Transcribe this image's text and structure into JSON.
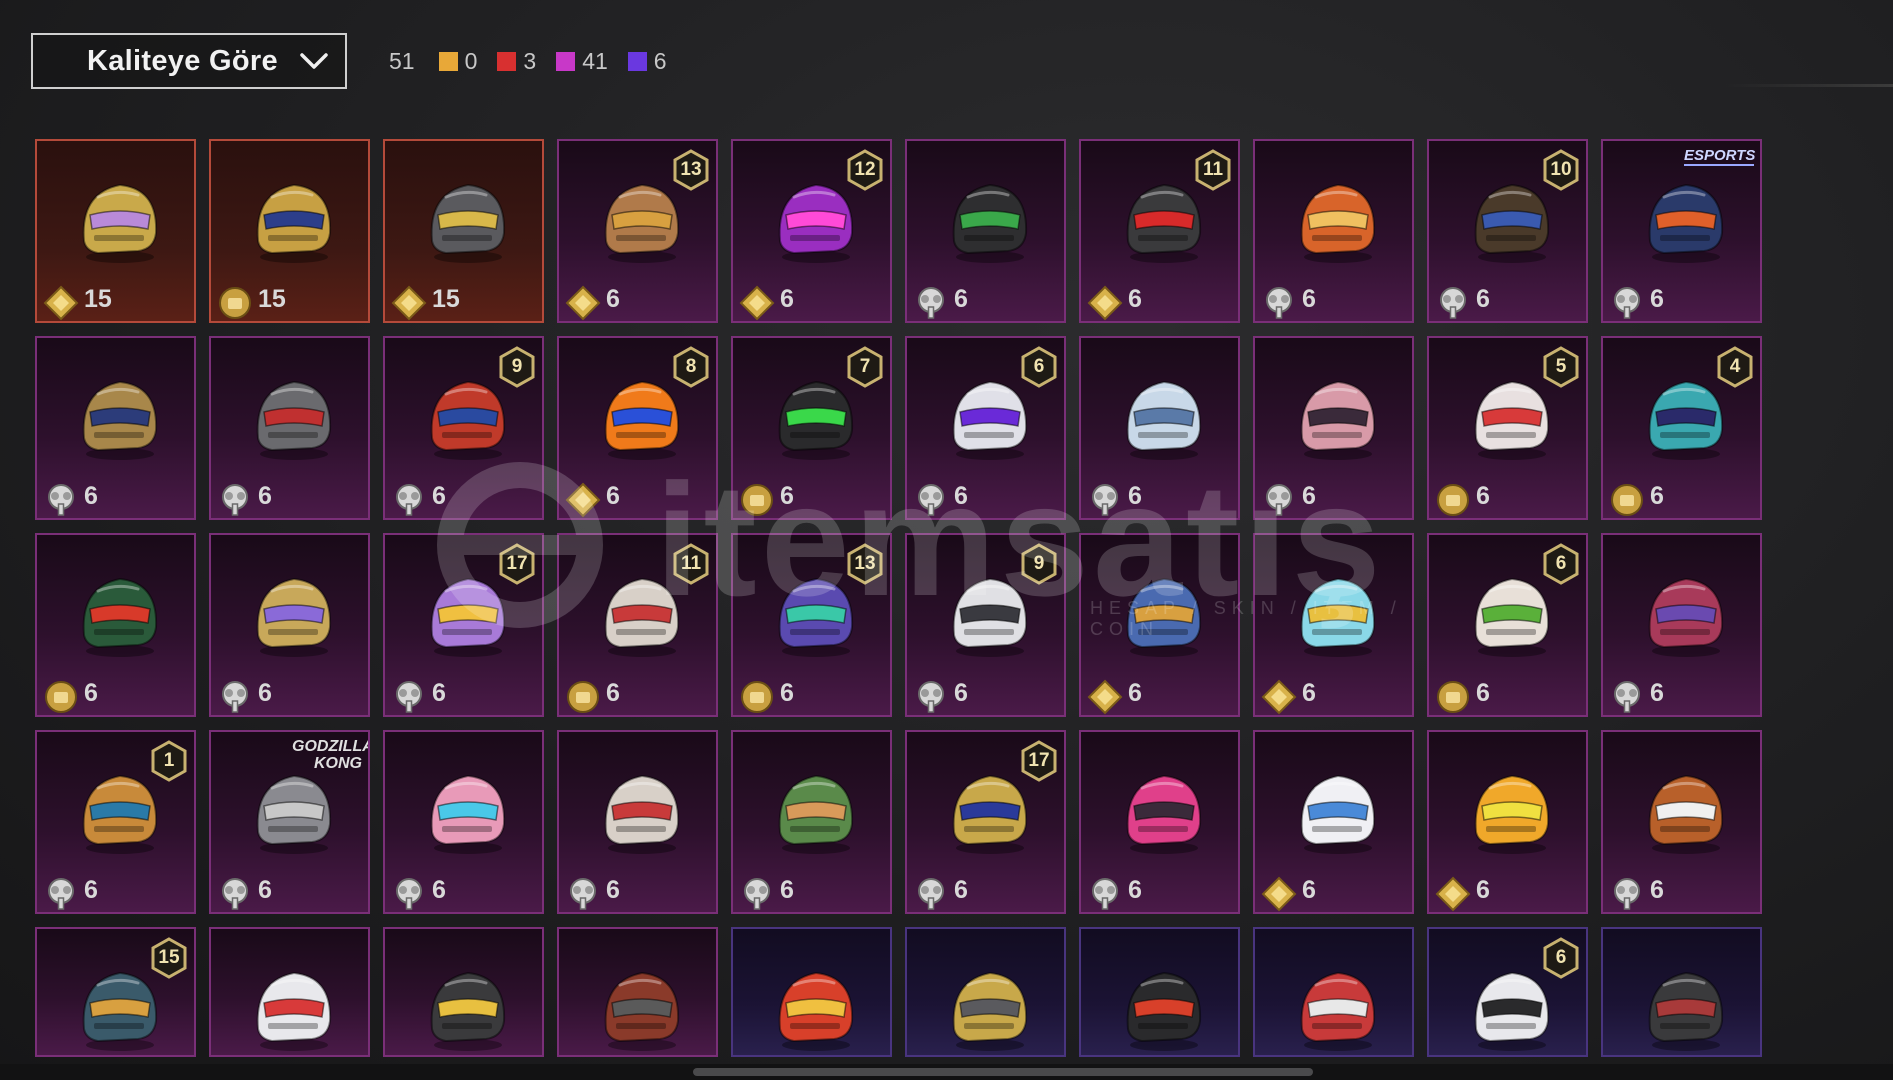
{
  "sort": {
    "label": "Kaliteye Göre"
  },
  "counts": {
    "total": "51",
    "items": [
      {
        "color": "#e8a838",
        "value": "0"
      },
      {
        "color": "#d83030",
        "value": "3"
      },
      {
        "color": "#c838c8",
        "value": "41"
      },
      {
        "color": "#6a38e0",
        "value": "6"
      }
    ]
  },
  "watermark": {
    "text": "itemsatış",
    "sub": "HESAP / SKIN / ITEM / COIN"
  },
  "cards": [
    {
      "rarity": "legend",
      "icon": "gold-diamond",
      "value": "15",
      "badge": "",
      "brand": "",
      "helmet": "#c9a94a",
      "accent": "#b98ad8"
    },
    {
      "rarity": "legend",
      "icon": "gold-coin",
      "value": "15",
      "badge": "",
      "brand": "",
      "helmet": "#c7a043",
      "accent": "#2c3e8a"
    },
    {
      "rarity": "legend",
      "icon": "gold-diamond",
      "value": "15",
      "badge": "",
      "brand": "",
      "helmet": "#5a5a5e",
      "accent": "#d8b84a"
    },
    {
      "rarity": "mythic",
      "icon": "gold-diamond",
      "value": "6",
      "badge": "13",
      "brand": "",
      "helmet": "#b07a4a",
      "accent": "#d8a040"
    },
    {
      "rarity": "mythic",
      "icon": "gold-diamond",
      "value": "6",
      "badge": "12",
      "brand": "",
      "helmet": "#9a2ec0",
      "accent": "#ff4ad8"
    },
    {
      "rarity": "mythic",
      "icon": "silver-tree",
      "value": "6",
      "badge": "",
      "brand": "",
      "helmet": "#2e2e30",
      "accent": "#3aa84a"
    },
    {
      "rarity": "mythic",
      "icon": "gold-diamond",
      "value": "6",
      "badge": "11",
      "brand": "",
      "helmet": "#3a3a3c",
      "accent": "#d82a2a"
    },
    {
      "rarity": "mythic",
      "icon": "silver-tree",
      "value": "6",
      "badge": "",
      "brand": "",
      "helmet": "#d8642a",
      "accent": "#f0c060"
    },
    {
      "rarity": "mythic",
      "icon": "silver-tree",
      "value": "6",
      "badge": "10",
      "brand": "",
      "helmet": "#4a3a2a",
      "accent": "#3a5ab0"
    },
    {
      "rarity": "mythic",
      "icon": "silver-tree",
      "value": "6",
      "badge": "",
      "brand": "ESPORTS",
      "helmet": "#2a3a6a",
      "accent": "#e0602a"
    },
    {
      "rarity": "mythic",
      "icon": "silver-tree",
      "value": "6",
      "badge": "",
      "brand": "",
      "helmet": "#a8874a",
      "accent": "#2c3c7a"
    },
    {
      "rarity": "mythic",
      "icon": "silver-tree",
      "value": "6",
      "badge": "",
      "brand": "",
      "helmet": "#6a6a6e",
      "accent": "#c03030"
    },
    {
      "rarity": "mythic",
      "icon": "silver-tree",
      "value": "6",
      "badge": "9",
      "brand": "",
      "helmet": "#c03a2a",
      "accent": "#2a4aa0"
    },
    {
      "rarity": "mythic",
      "icon": "gold-diamond",
      "value": "6",
      "badge": "8",
      "brand": "",
      "helmet": "#f07a1a",
      "accent": "#2a50d8"
    },
    {
      "rarity": "mythic",
      "icon": "gold-coin",
      "value": "6",
      "badge": "7",
      "brand": "",
      "helmet": "#2a2a2c",
      "accent": "#3ad84a"
    },
    {
      "rarity": "mythic",
      "icon": "silver-tree",
      "value": "6",
      "badge": "6",
      "brand": "",
      "helmet": "#e0e0e8",
      "accent": "#6a2ad8"
    },
    {
      "rarity": "mythic",
      "icon": "silver-tree",
      "value": "6",
      "badge": "",
      "brand": "",
      "helmet": "#c8d8e8",
      "accent": "#5a7aa8"
    },
    {
      "rarity": "mythic",
      "icon": "silver-tree",
      "value": "6",
      "badge": "",
      "brand": "",
      "helmet": "#d89aa8",
      "accent": "#3a2a3a"
    },
    {
      "rarity": "mythic",
      "icon": "gold-coin",
      "value": "6",
      "badge": "5",
      "brand": "",
      "helmet": "#e8e0e0",
      "accent": "#d83a3a"
    },
    {
      "rarity": "mythic",
      "icon": "gold-coin",
      "value": "6",
      "badge": "4",
      "brand": "",
      "helmet": "#3aa8b0",
      "accent": "#2a2a6a"
    },
    {
      "rarity": "mythic",
      "icon": "gold-coin",
      "value": "6",
      "badge": "",
      "brand": "",
      "helmet": "#2a5a3a",
      "accent": "#d83a2a"
    },
    {
      "rarity": "mythic",
      "icon": "silver-tree",
      "value": "6",
      "badge": "",
      "brand": "",
      "helmet": "#c8a85a",
      "accent": "#8a6ad8"
    },
    {
      "rarity": "mythic",
      "icon": "silver-tree",
      "value": "6",
      "badge": "17",
      "brand": "",
      "helmet": "#a87ad8",
      "accent": "#f0c040"
    },
    {
      "rarity": "mythic",
      "icon": "gold-coin",
      "value": "6",
      "badge": "11",
      "brand": "",
      "helmet": "#d8d0c8",
      "accent": "#c83a3a"
    },
    {
      "rarity": "mythic",
      "icon": "gold-coin",
      "value": "6",
      "badge": "13",
      "brand": "",
      "helmet": "#5a4ab0",
      "accent": "#3ac8a8"
    },
    {
      "rarity": "mythic",
      "icon": "silver-tree",
      "value": "6",
      "badge": "9",
      "brand": "",
      "helmet": "#e0e0e4",
      "accent": "#3a3a40"
    },
    {
      "rarity": "mythic",
      "icon": "gold-diamond",
      "value": "6",
      "badge": "",
      "brand": "",
      "helmet": "#4a6ab0",
      "accent": "#d8a040"
    },
    {
      "rarity": "mythic",
      "icon": "gold-diamond",
      "value": "6",
      "badge": "",
      "brand": "",
      "helmet": "#8ad8e8",
      "accent": "#e8c040"
    },
    {
      "rarity": "mythic",
      "icon": "gold-coin",
      "value": "6",
      "badge": "6",
      "brand": "",
      "helmet": "#e8e0d8",
      "accent": "#5ab03a"
    },
    {
      "rarity": "mythic",
      "icon": "silver-tree",
      "value": "6",
      "badge": "",
      "brand": "",
      "helmet": "#a83a5a",
      "accent": "#6a4ab0"
    },
    {
      "rarity": "mythic",
      "icon": "silver-tree",
      "value": "6",
      "badge": "1",
      "brand": "",
      "helmet": "#c88a3a",
      "accent": "#2a7aa8"
    },
    {
      "rarity": "mythic",
      "icon": "silver-tree",
      "value": "6",
      "badge": "",
      "brand": "GODZILLA KONG",
      "helmet": "#8a8a90",
      "accent": "#c8c8c8"
    },
    {
      "rarity": "mythic",
      "icon": "silver-tree",
      "value": "6",
      "badge": "",
      "brand": "",
      "helmet": "#e89ab8",
      "accent": "#4ac8e8"
    },
    {
      "rarity": "mythic",
      "icon": "silver-tree",
      "value": "6",
      "badge": "",
      "brand": "",
      "helmet": "#d8d0c8",
      "accent": "#c83a3a"
    },
    {
      "rarity": "mythic",
      "icon": "silver-tree",
      "value": "6",
      "badge": "",
      "brand": "",
      "helmet": "#5a8a4a",
      "accent": "#d89a5a"
    },
    {
      "rarity": "mythic",
      "icon": "silver-tree",
      "value": "6",
      "badge": "17",
      "brand": "",
      "helmet": "#c8a84a",
      "accent": "#2a3a9a"
    },
    {
      "rarity": "mythic",
      "icon": "silver-tree",
      "value": "6",
      "badge": "",
      "brand": "",
      "helmet": "#e0408a",
      "accent": "#3a2a3a"
    },
    {
      "rarity": "mythic",
      "icon": "gold-diamond",
      "value": "6",
      "badge": "",
      "brand": "",
      "helmet": "#f0f0f4",
      "accent": "#4a8ad8"
    },
    {
      "rarity": "mythic",
      "icon": "gold-diamond",
      "value": "6",
      "badge": "",
      "brand": "",
      "helmet": "#f0a82a",
      "accent": "#f0e040"
    },
    {
      "rarity": "mythic",
      "icon": "silver-tree",
      "value": "6",
      "badge": "",
      "brand": "",
      "helmet": "#b8602a",
      "accent": "#f0f0f0"
    },
    {
      "rarity": "mythic",
      "icon": "",
      "value": "",
      "badge": "15",
      "brand": "",
      "helmet": "#3a5a6a",
      "accent": "#d8a040"
    },
    {
      "rarity": "mythic",
      "icon": "",
      "value": "",
      "badge": "",
      "brand": "",
      "helmet": "#e8e8ec",
      "accent": "#d83a3a"
    },
    {
      "rarity": "mythic",
      "icon": "",
      "value": "",
      "badge": "",
      "brand": "",
      "helmet": "#3a3a3c",
      "accent": "#e8c040"
    },
    {
      "rarity": "mythic",
      "icon": "",
      "value": "",
      "badge": "",
      "brand": "",
      "helmet": "#8a3a2a",
      "accent": "#5a5a5a"
    },
    {
      "rarity": "epic",
      "icon": "",
      "value": "",
      "badge": "",
      "brand": "",
      "helmet": "#d8402a",
      "accent": "#f0c040"
    },
    {
      "rarity": "epic",
      "icon": "",
      "value": "",
      "badge": "",
      "brand": "",
      "helmet": "#c8a84a",
      "accent": "#5a5a5e"
    },
    {
      "rarity": "epic",
      "icon": "",
      "value": "",
      "badge": "",
      "brand": "",
      "helmet": "#2a2a2c",
      "accent": "#d8402a"
    },
    {
      "rarity": "epic",
      "icon": "",
      "value": "",
      "badge": "",
      "brand": "",
      "helmet": "#c83a3a",
      "accent": "#e8e8e8"
    },
    {
      "rarity": "epic",
      "icon": "",
      "value": "",
      "badge": "6",
      "brand": "",
      "helmet": "#e8e8ec",
      "accent": "#2a2a2c"
    },
    {
      "rarity": "epic",
      "icon": "",
      "value": "",
      "badge": "",
      "brand": "",
      "helmet": "#3a3a3c",
      "accent": "#a83a3a"
    }
  ]
}
